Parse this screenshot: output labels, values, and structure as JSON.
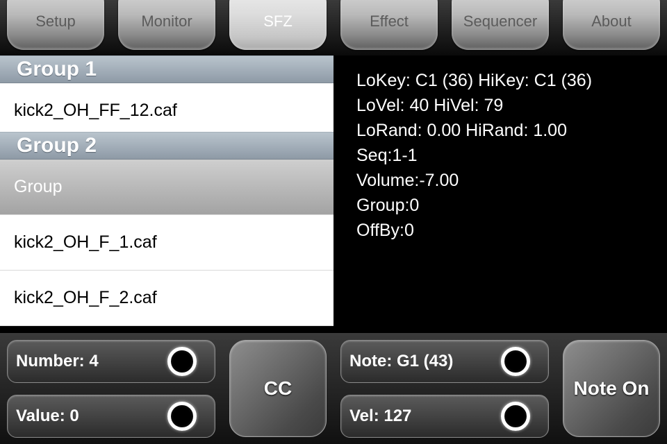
{
  "tabs": [
    {
      "label": "Setup",
      "active": false
    },
    {
      "label": "Monitor",
      "active": false
    },
    {
      "label": "SFZ",
      "active": true
    },
    {
      "label": "Effect",
      "active": false
    },
    {
      "label": "Sequencer",
      "active": false
    },
    {
      "label": "About",
      "active": false
    }
  ],
  "list": {
    "group1": {
      "header": "Group 1",
      "items": [
        "kick2_OH_FF_12.caf"
      ]
    },
    "group2": {
      "header": "Group 2",
      "selected_item": "Group",
      "items": [
        "kick2_OH_F_1.caf",
        "kick2_OH_F_2.caf"
      ]
    }
  },
  "info": {
    "lines": [
      "LoKey: C1 (36) HiKey: C1 (36)",
      "LoVel: 40 HiVel: 79",
      "LoRand: 0.00 HiRand: 1.00",
      "Seq:1-1",
      "Volume:-7.00",
      "Group:0",
      "OffBy:0"
    ]
  },
  "controls": {
    "number_label": "Number: 4",
    "value_label": "Value: 0",
    "cc_button": "CC",
    "note_label": "Note: G1 (43)",
    "vel_label": "Vel: 127",
    "note_on_button": "Note On"
  }
}
